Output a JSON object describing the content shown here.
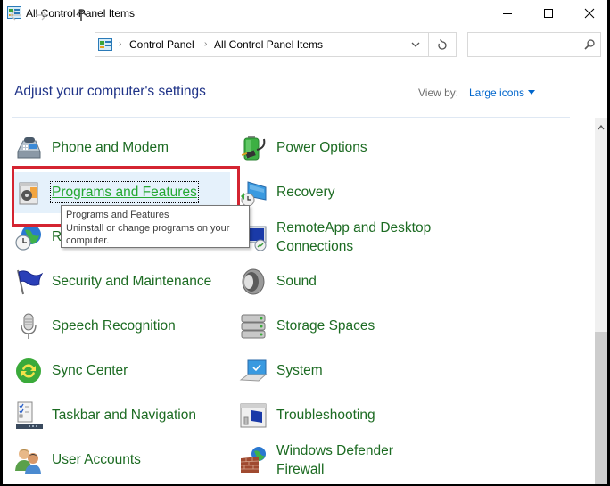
{
  "window": {
    "title": "All Control Panel Items",
    "controls": {
      "minimize": "minimize",
      "maximize": "maximize",
      "close": "close"
    }
  },
  "navigation": {
    "back_icon": "arrow-left-icon",
    "forward_icon": "arrow-right-icon",
    "recent_icon": "chevron-down-icon",
    "up_icon": "arrow-up-icon",
    "breadcrumb": [
      "Control Panel",
      "All Control Panel Items"
    ],
    "refresh_icon": "refresh-icon",
    "search": {
      "value": "",
      "placeholder": ""
    }
  },
  "content": {
    "heading": "Adjust your computer's settings",
    "view_by_label": "View by:",
    "view_by_value": "Large icons"
  },
  "items_left": [
    {
      "label": "Phone and Modem",
      "icon": "phone-modem-icon"
    },
    {
      "label": "Programs and Features",
      "icon": "programs-features-icon",
      "state": "hover"
    },
    {
      "label": "Region",
      "icon": "region-icon"
    },
    {
      "label": "Security and Maintenance",
      "icon": "flag-icon"
    },
    {
      "label": "Speech Recognition",
      "icon": "microphone-icon"
    },
    {
      "label": "Sync Center",
      "icon": "sync-icon"
    },
    {
      "label": "Taskbar and Navigation",
      "icon": "taskbar-icon"
    },
    {
      "label": "User Accounts",
      "icon": "users-icon"
    }
  ],
  "items_right": [
    {
      "label": "Power Options",
      "icon": "battery-icon"
    },
    {
      "label": "Recovery",
      "icon": "recovery-icon"
    },
    {
      "label": "RemoteApp and Desktop",
      "label2": "Connections",
      "icon": "remote-desktop-icon"
    },
    {
      "label": "Sound",
      "icon": "speaker-icon"
    },
    {
      "label": "Storage Spaces",
      "icon": "storage-icon"
    },
    {
      "label": "System",
      "icon": "computer-icon"
    },
    {
      "label": "Troubleshooting",
      "icon": "troubleshooting-icon"
    },
    {
      "label": "Windows Defender",
      "label2": "Firewall",
      "icon": "firewall-icon"
    }
  ],
  "tooltip": {
    "title": "Programs and Features",
    "description": "Uninstall or change programs on your computer."
  },
  "colors": {
    "link_green": "#1c6b22",
    "hover_green": "#25a832",
    "heading_blue": "#1e3287",
    "highlight_red": "#d42431"
  }
}
